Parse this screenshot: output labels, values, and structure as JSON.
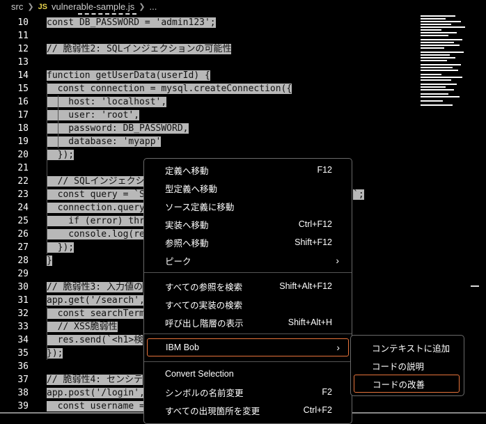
{
  "breadcrumb": {
    "folder": "src",
    "file_badge": "JS",
    "file": "vulnerable-sample.js",
    "more": "..."
  },
  "editor": {
    "lines": [
      {
        "num": "10",
        "text": "const DB_PASSWORD = 'admin123';"
      },
      {
        "num": "11",
        "text": ""
      },
      {
        "num": "12",
        "text": "// 脆弱性2: SQLインジェクションの可能性"
      },
      {
        "num": "13",
        "text": ""
      },
      {
        "num": "14",
        "text": "function getUserData(userId) {"
      },
      {
        "num": "15",
        "text": "  const connection = mysql.createConnection({"
      },
      {
        "num": "16",
        "text": "    host: 'localhost',"
      },
      {
        "num": "17",
        "text": "    user: 'root',"
      },
      {
        "num": "18",
        "text": "    password: DB_PASSWORD,"
      },
      {
        "num": "19",
        "text": "    database: 'myapp'"
      },
      {
        "num": "20",
        "text": "  });"
      },
      {
        "num": "21",
        "text": ""
      },
      {
        "num": "22",
        "text": "  // SQLインジェクシ"
      },
      {
        "num": "23",
        "text": "  const query = `S"
      },
      {
        "num": "24",
        "text": "  connection.query"
      },
      {
        "num": "25",
        "text": "    if (error) thr"
      },
      {
        "num": "26",
        "text": "    console.log(re"
      },
      {
        "num": "27",
        "text": "  });"
      },
      {
        "num": "28",
        "text": "}"
      },
      {
        "num": "29",
        "text": ""
      },
      {
        "num": "30",
        "text": "// 脆弱性3: 入力値の"
      },
      {
        "num": "31",
        "text": "app.get('/search',"
      },
      {
        "num": "32",
        "text": "  const searchTerm"
      },
      {
        "num": "33",
        "text": "  // XSS脆弱性"
      },
      {
        "num": "34",
        "text": "  res.send(`<h1>検"
      },
      {
        "num": "35",
        "text": "});"
      },
      {
        "num": "36",
        "text": ""
      },
      {
        "num": "37",
        "text": "// 脆弱性4: センシテ"
      },
      {
        "num": "38",
        "text": "app.post('/login',"
      },
      {
        "num": "39",
        "text": "  const username ="
      }
    ],
    "line23_tail": "`;"
  },
  "context_menu": {
    "items": [
      {
        "label": "定義へ移動",
        "shortcut": "F12"
      },
      {
        "label": "型定義へ移動",
        "shortcut": ""
      },
      {
        "label": "ソース定義に移動",
        "shortcut": ""
      },
      {
        "label": "実装へ移動",
        "shortcut": "Ctrl+F12"
      },
      {
        "label": "参照へ移動",
        "shortcut": "Shift+F12"
      },
      {
        "label": "ピーク",
        "shortcut": ""
      },
      {
        "label": "すべての参照を検索",
        "shortcut": "Shift+Alt+F12"
      },
      {
        "label": "すべての実装の検索",
        "shortcut": ""
      },
      {
        "label": "呼び出し階層の表示",
        "shortcut": "Shift+Alt+H"
      },
      {
        "label": "IBM Bob",
        "shortcut": ""
      },
      {
        "label": "Convert Selection",
        "shortcut": ""
      },
      {
        "label": "シンボルの名前変更",
        "shortcut": "F2"
      },
      {
        "label": "すべての出現箇所を変更",
        "shortcut": "Ctrl+F2"
      }
    ],
    "submenu_arrow": "›"
  },
  "submenu": {
    "items": [
      {
        "label": "コンテキストに追加"
      },
      {
        "label": "コードの説明"
      },
      {
        "label": "コードの改善"
      }
    ]
  },
  "colors": {
    "accent": "#e8743b",
    "selection": "#b8b8b8",
    "background": "#000000"
  }
}
